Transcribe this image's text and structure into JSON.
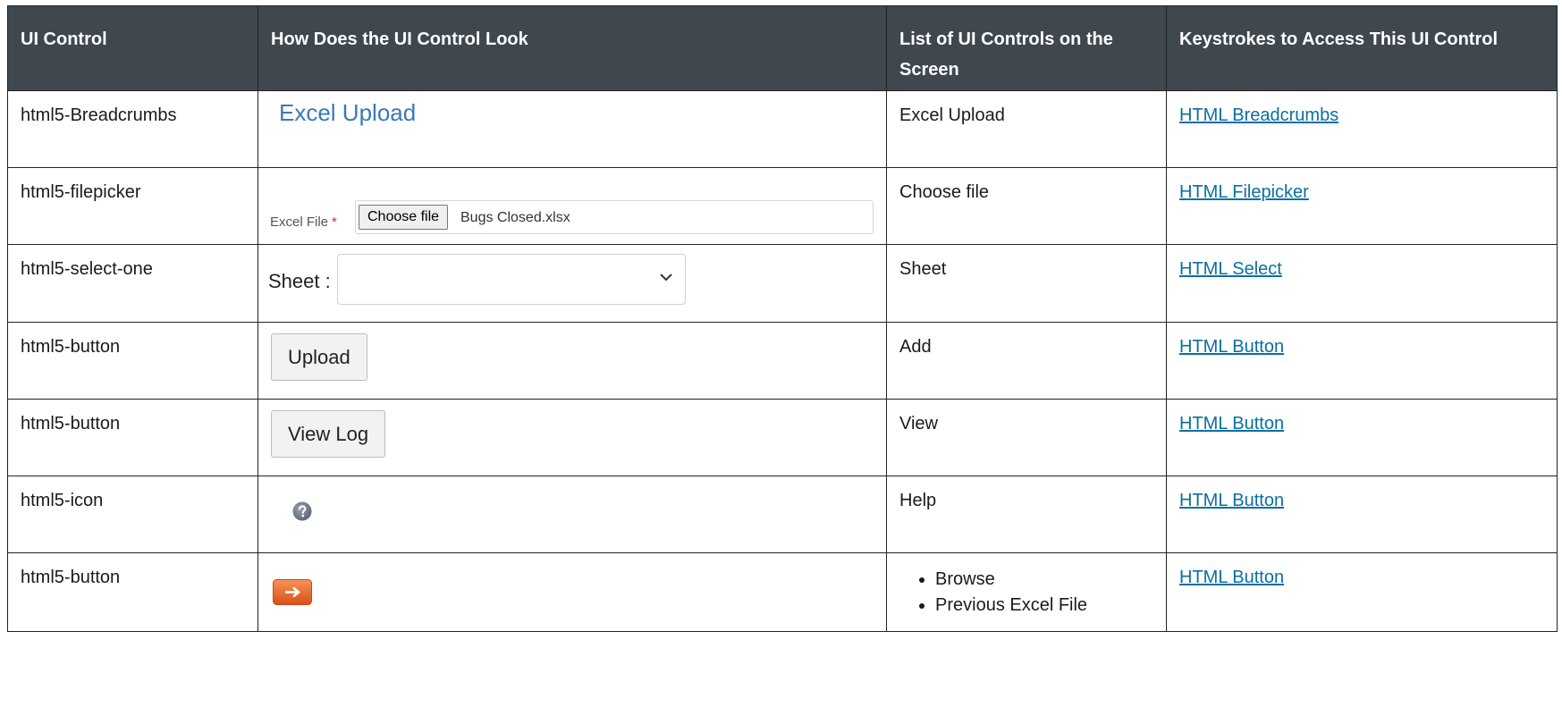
{
  "headers": {
    "col1": "UI Control",
    "col2": "How Does the UI Control Look",
    "col3": "List of UI Controls on the Screen",
    "col4": "Keystrokes to Access This UI Control"
  },
  "rows": [
    {
      "control": "html5-Breadcrumbs",
      "preview": {
        "link_text": "Excel Upload"
      },
      "list": "Excel Upload",
      "keystroke": "HTML Breadcrumbs"
    },
    {
      "control": "html5-filepicker",
      "preview": {
        "label": "Excel File",
        "required_mark": "*",
        "button": "Choose file",
        "filename": "Bugs Closed.xlsx"
      },
      "list": "Choose file",
      "keystroke": "HTML Filepicker"
    },
    {
      "control": "html5-select-one",
      "preview": {
        "label": "Sheet :"
      },
      "list": "Sheet",
      "keystroke": "HTML Select"
    },
    {
      "control": "html5-button",
      "preview": {
        "button": "Upload"
      },
      "list": "Add",
      "keystroke": "HTML Button"
    },
    {
      "control": "html5-button",
      "preview": {
        "button": "View Log"
      },
      "list": "View",
      "keystroke": "HTML Button"
    },
    {
      "control": "html5-icon",
      "preview": {
        "icon": "help-icon"
      },
      "list": "Help",
      "keystroke": "HTML Button"
    },
    {
      "control": "html5-button",
      "preview": {
        "icon": "arrow-right-icon"
      },
      "list_items": [
        "Browse",
        "Previous Excel File"
      ],
      "keystroke": "HTML Button"
    }
  ],
  "colors": {
    "header_bg": "#3f474f",
    "link": "#0b6fa0",
    "breadcrumb": "#3a79b8",
    "arrow_icon": "#e8601c"
  }
}
